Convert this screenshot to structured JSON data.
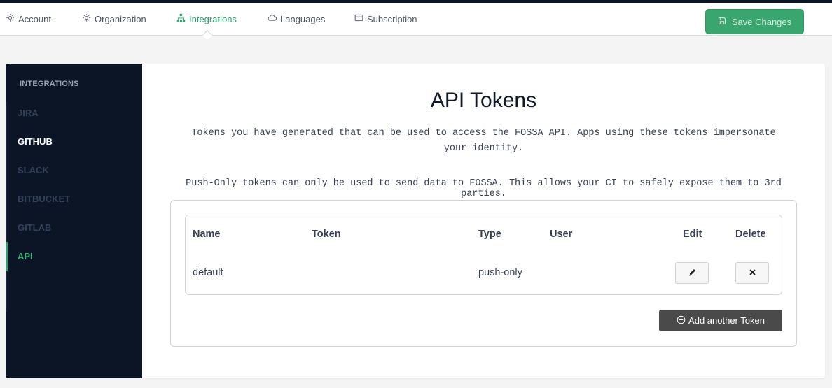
{
  "topnav": {
    "tabs": [
      {
        "label": "Account",
        "icon": "gear-icon"
      },
      {
        "label": "Organization",
        "icon": "gear-icon"
      },
      {
        "label": "Integrations",
        "icon": "sitemap-icon",
        "active": true
      },
      {
        "label": "Languages",
        "icon": "cloud-icon"
      },
      {
        "label": "Subscription",
        "icon": "credit-card-icon"
      }
    ],
    "save_label": "Save Changes",
    "accent_color": "#2fa16b"
  },
  "sidebar": {
    "heading": "INTEGRATIONS",
    "items": [
      {
        "label": "JIRA"
      },
      {
        "label": "GITHUB"
      },
      {
        "label": "SLACK"
      },
      {
        "label": "BITBUCKET"
      },
      {
        "label": "GITLAB"
      },
      {
        "label": "API",
        "active": true
      }
    ]
  },
  "main": {
    "title": "API Tokens",
    "description": "Tokens you have generated that can be used to access the FOSSA API. Apps using these tokens impersonate your identity.",
    "push_only_note": "Push-Only tokens can only be used to send data to FOSSA. This allows your CI to safely expose them to 3rd parties.",
    "table": {
      "columns": [
        "Name",
        "Token",
        "Type",
        "User",
        "Edit",
        "Delete"
      ],
      "rows": [
        {
          "name": "default",
          "token": "",
          "type": "push-only",
          "user": ""
        }
      ]
    },
    "add_token_label": "Add another Token"
  }
}
